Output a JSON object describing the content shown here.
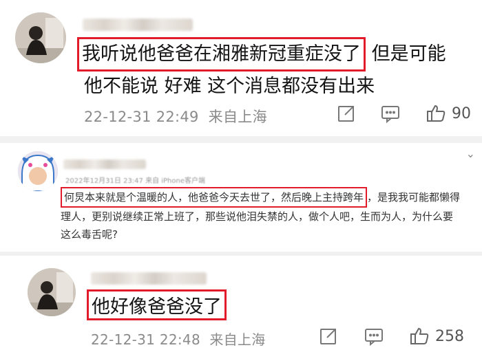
{
  "comment1": {
    "text_highlight": "我听说他爸爸在湘雅新冠重症没了",
    "text_rest": "但是可能",
    "text_line2": "他不能说 好难 这个消息都没有出来",
    "timestamp": "22-12-31 22:49",
    "location": "来自上海",
    "likes": "90"
  },
  "comment2": {
    "meta_blurred": "2022年12月31日 23:47 来自 iPhone客户端",
    "text_highlight": "何炅本来就是个温暖的人，他爸爸今天去世了，然后晚上主持跨年",
    "text_rest": "，是我我可能都懒得",
    "text_line2": "理人，更别说继续正常上班了，那些说他泪失禁的人，做个人吧，生而为人，为什么要",
    "text_line3": "这么毒舌呢?"
  },
  "comment3": {
    "text_highlight": "他好像爸爸没了",
    "timestamp": "22-12-31 22:48",
    "location": "来自上海",
    "likes": "258"
  },
  "icons": {
    "share": "share-icon",
    "comment": "comment-icon",
    "like": "thumbs-up-icon",
    "more": "more-icon"
  },
  "colors": {
    "highlight_border": "#e21b2b",
    "meta_gray": "#8a8a8a"
  }
}
